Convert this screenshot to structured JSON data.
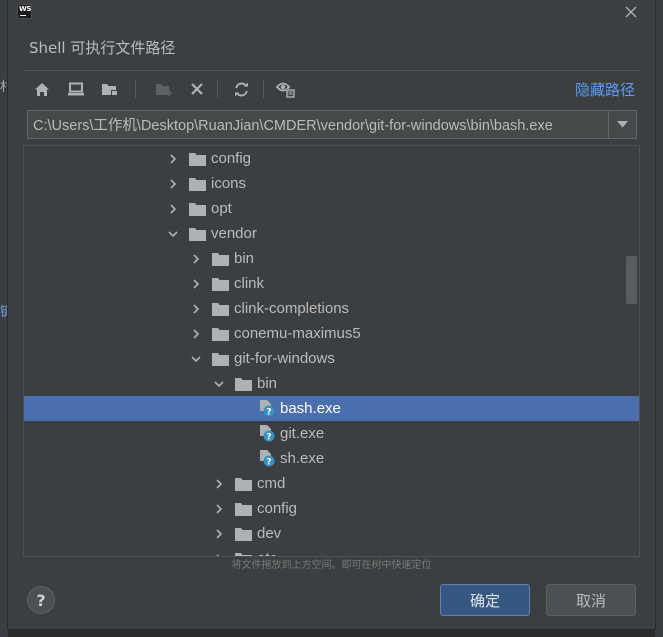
{
  "dialog": {
    "app_logo": "WS",
    "title": "Shell 可执行文件路径",
    "hide_path_label": "隐藏路径",
    "path_value": "C:\\Users\\工作机\\Desktop\\RuanJian\\CMDER\\vendor\\git-for-windows\\bin\\bash.exe",
    "hint": "将文件拖放到上方空间。即可在树中快速定位",
    "ok_label": "确定",
    "cancel_label": "取消",
    "help_label": "?"
  },
  "background": {
    "left_glyph_1": "村",
    "left_glyph_2": "键"
  },
  "toolbar": {
    "icons": [
      "home-icon",
      "desktop-icon",
      "project-folder-icon",
      "new-folder-icon",
      "delete-icon",
      "refresh-icon",
      "show-hidden-icon"
    ]
  },
  "tree": {
    "rows": [
      {
        "label": "config",
        "type": "folder",
        "expanded": false
      },
      {
        "label": "icons",
        "type": "folder",
        "expanded": false
      },
      {
        "label": "opt",
        "type": "folder",
        "expanded": false
      },
      {
        "label": "vendor",
        "type": "folder",
        "expanded": true
      },
      {
        "label": "bin",
        "type": "folder",
        "expanded": false
      },
      {
        "label": "clink",
        "type": "folder",
        "expanded": false
      },
      {
        "label": "clink-completions",
        "type": "folder",
        "expanded": false
      },
      {
        "label": "conemu-maximus5",
        "type": "folder",
        "expanded": false
      },
      {
        "label": "git-for-windows",
        "type": "folder",
        "expanded": true
      },
      {
        "label": "bin",
        "type": "folder",
        "expanded": true
      },
      {
        "label": "bash.exe",
        "type": "file",
        "selected": true
      },
      {
        "label": "git.exe",
        "type": "file"
      },
      {
        "label": "sh.exe",
        "type": "file"
      },
      {
        "label": "cmd",
        "type": "folder",
        "expanded": false
      },
      {
        "label": "config",
        "type": "folder",
        "expanded": false
      },
      {
        "label": "dev",
        "type": "folder",
        "expanded": false
      },
      {
        "label": "etc",
        "type": "folder",
        "expanded": false
      }
    ]
  },
  "colors": {
    "accent": "#589df6",
    "selection": "#4b6eaf",
    "panel": "#3c3f41",
    "primary_button": "#365880"
  }
}
